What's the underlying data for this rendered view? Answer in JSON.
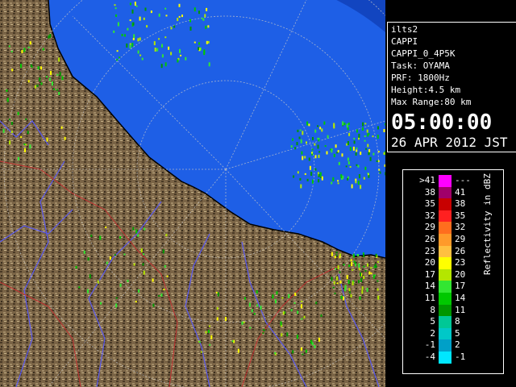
{
  "info": {
    "lines": [
      "ilts2",
      "CAPPI",
      "CAPPI_0_4P5K",
      "Task: OYAMA",
      "PRF: 1800Hz",
      "Height:4.5 km",
      "Max Range:80 km"
    ],
    "time": "05:00:00",
    "date": "26 APR 2012 JST"
  },
  "legend": {
    "title": "Reflectivity in dBZ",
    "rows": [
      {
        "left": ">41",
        "right": "---",
        "color": "#ff00ff"
      },
      {
        "left": "38",
        "right": "41",
        "color": "#a0006a"
      },
      {
        "left": "35",
        "right": "38",
        "color": "#c80000"
      },
      {
        "left": "32",
        "right": "35",
        "color": "#ff2020"
      },
      {
        "left": "29",
        "right": "32",
        "color": "#ff6e1e"
      },
      {
        "left": "26",
        "right": "29",
        "color": "#ff9a2a"
      },
      {
        "left": "23",
        "right": "26",
        "color": "#ffc040"
      },
      {
        "left": "20",
        "right": "23",
        "color": "#ffff00"
      },
      {
        "left": "17",
        "right": "20",
        "color": "#b4e600"
      },
      {
        "left": "14",
        "right": "17",
        "color": "#32e632"
      },
      {
        "left": "11",
        "right": "14",
        "color": "#00c800"
      },
      {
        "left": "8",
        "right": "11",
        "color": "#009600"
      },
      {
        "left": "5",
        "right": "8",
        "color": "#00c896"
      },
      {
        "left": "2",
        "right": "5",
        "color": "#00c8c8"
      },
      {
        "left": "-1",
        "right": "2",
        "color": "#00a0c8"
      },
      {
        "left": "-4",
        "right": "-1",
        "color": "#00e6ff"
      }
    ]
  },
  "colors": {
    "sea": "#1e5fe6",
    "land": "#7a6446",
    "river": "#5a5af0",
    "border": "#c03030"
  }
}
